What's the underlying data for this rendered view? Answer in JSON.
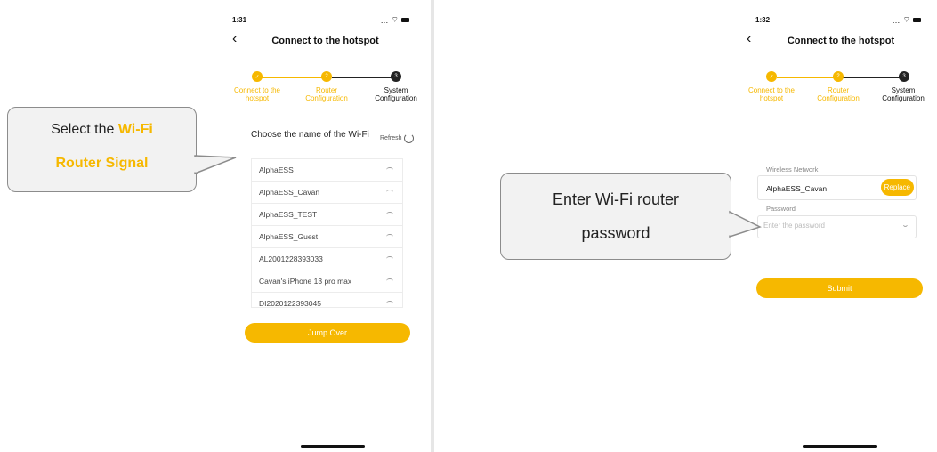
{
  "colors": {
    "accent": "#f6b800",
    "dark": "#222222",
    "callout_bg": "#f2f2f2"
  },
  "screen1": {
    "time": "1:31",
    "title": "Connect to the hotspot",
    "steps": [
      {
        "label_line1": "Connect to the",
        "label_line2": "hotspot",
        "state": "done"
      },
      {
        "label_line1": "Router",
        "label_line2": "Configuration",
        "state": "done",
        "number": "2"
      },
      {
        "label_line1": "System",
        "label_line2": "Configuration",
        "state": "current",
        "number": "3"
      }
    ],
    "choose_label": "Choose the name of the Wi-Fi",
    "refresh_label": "Refresh",
    "wifi_networks": [
      "AlphaESS",
      "AlphaESS_Cavan",
      "AlphaESS_TEST",
      "AlphaESS_Guest",
      "AL2001228393033",
      "Cavan's iPhone 13 pro max",
      "DI2020122393045"
    ],
    "jump_over_button": "Jump Over"
  },
  "screen2": {
    "time": "1:32",
    "title": "Connect to the hotspot",
    "steps": [
      {
        "label_line1": "Connect to the",
        "label_line2": "hotspot",
        "state": "done"
      },
      {
        "label_line1": "Router",
        "label_line2": "Configuration",
        "state": "done",
        "number": "2"
      },
      {
        "label_line1": "System",
        "label_line2": "Configuration",
        "state": "current",
        "number": "3"
      }
    ],
    "network_label": "Wireless Network",
    "network_value": "AlphaESS_Cavan",
    "replace_button": "Replace",
    "password_label": "Password",
    "password_placeholder": "Enter the password",
    "submit_button": "Submit"
  },
  "callouts": {
    "left_prefix": "Select the ",
    "left_highlight_1": "Wi-Fi",
    "left_highlight_2": "Router Signal",
    "right_line1": "Enter Wi-Fi router",
    "right_line2": "password"
  },
  "icons": [
    "back-chevron-icon",
    "wifi-signal-icon",
    "battery-icon",
    "refresh-icon",
    "wifi-icon",
    "eye-hidden-icon"
  ]
}
